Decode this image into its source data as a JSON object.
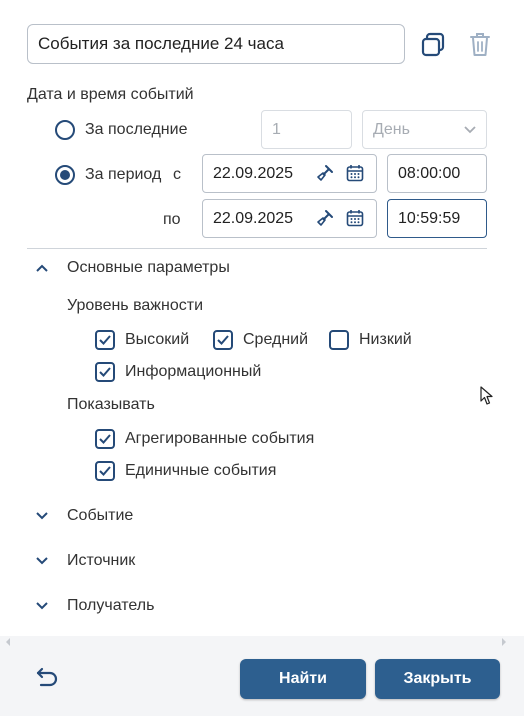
{
  "filter": {
    "name_value": "События за последние 24 часа"
  },
  "datetime": {
    "section_label": "Дата и время событий",
    "last_label": "За последние",
    "last_count": "1",
    "last_unit": "День",
    "period_label": "За период",
    "from_label": "с",
    "to_label": "по",
    "from_date": "22.09.2025",
    "from_time": "08:00:00",
    "to_date": "22.09.2025",
    "to_time": "10:59:59",
    "selected": "period"
  },
  "main_params": {
    "header": "Основные параметры",
    "severity_label": "Уровень важности",
    "severity": [
      {
        "label": "Высокий",
        "checked": true
      },
      {
        "label": "Средний",
        "checked": true
      },
      {
        "label": "Низкий",
        "checked": false
      },
      {
        "label": "Информационный",
        "checked": true
      }
    ],
    "show_label": "Показывать",
    "show": [
      {
        "label": "Агрегированные события",
        "checked": true
      },
      {
        "label": "Единичные события",
        "checked": true
      }
    ]
  },
  "sections": [
    {
      "label": "Событие"
    },
    {
      "label": "Источник"
    },
    {
      "label": "Получатель"
    }
  ],
  "footer": {
    "find_label": "Найти",
    "close_label": "Закрыть"
  },
  "colors": {
    "accent": "#254a78",
    "button": "#2d5f8f"
  }
}
